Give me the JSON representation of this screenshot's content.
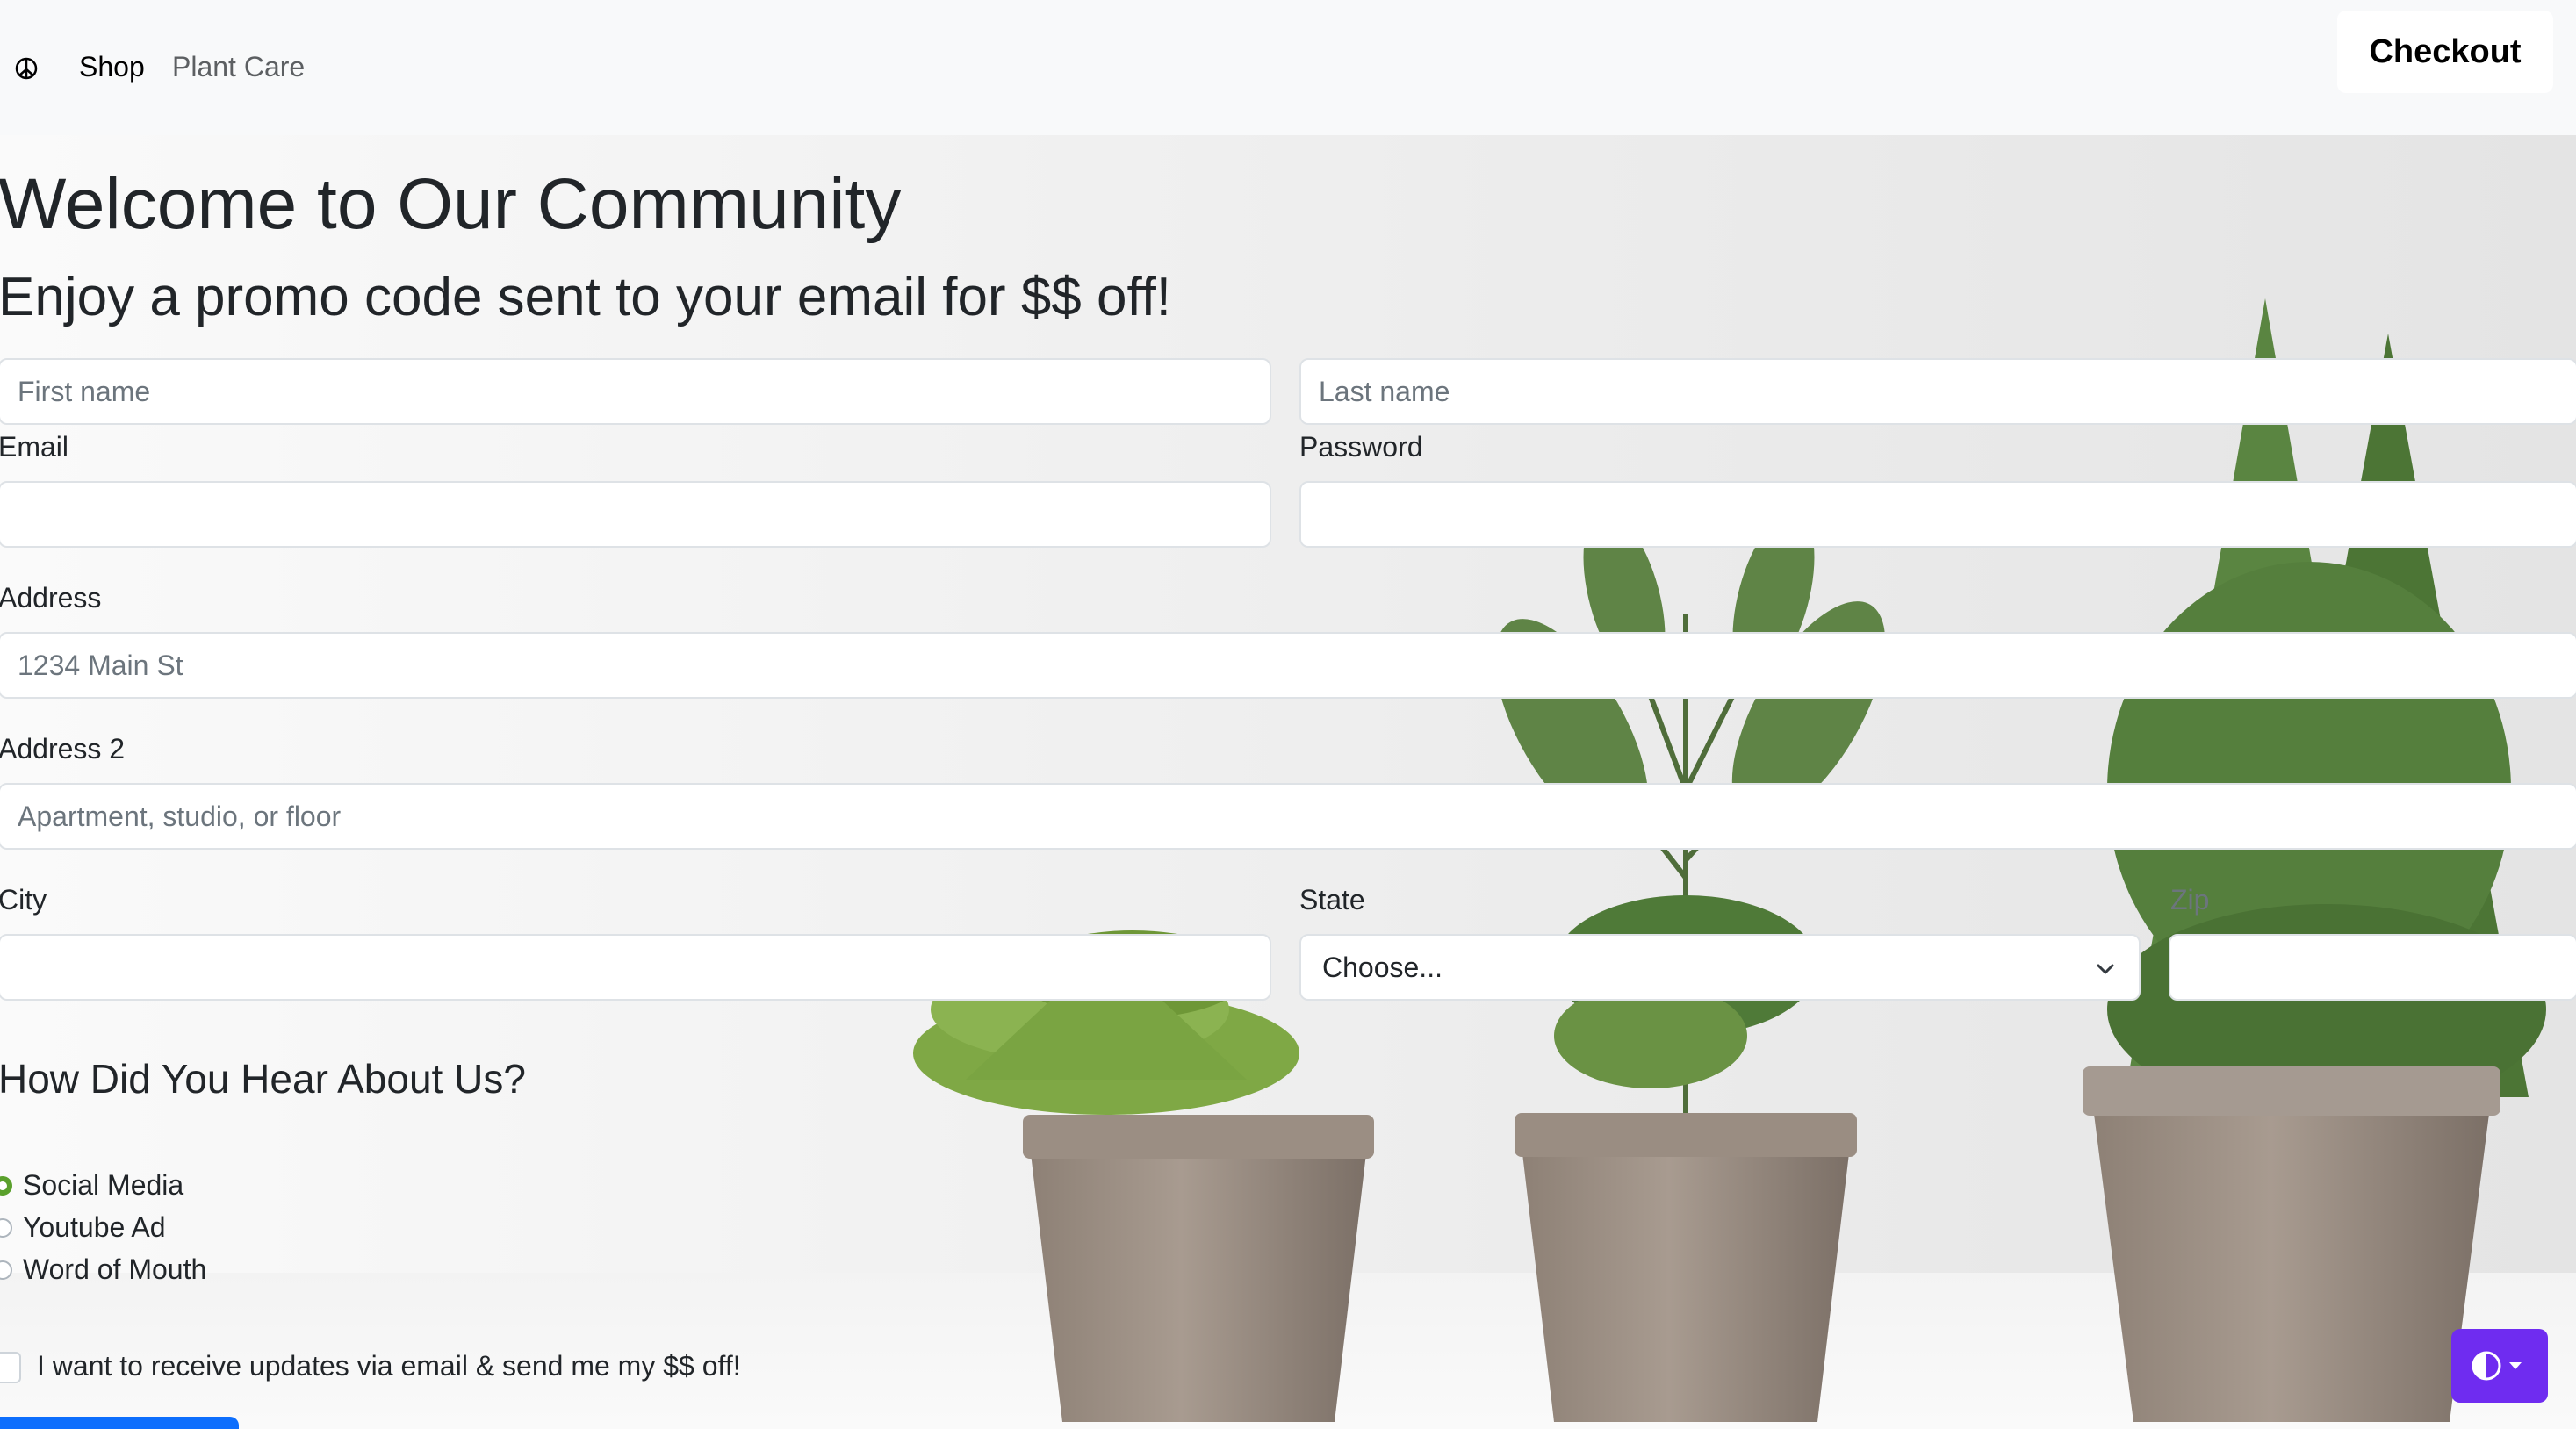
{
  "navbar": {
    "brand_icon": "peace-icon",
    "links": [
      "Shop",
      "Plant Care"
    ],
    "checkout_label": "Checkout"
  },
  "hero": {
    "title": "Welcome to Our Community",
    "subtitle": "Enjoy a promo code sent to your email for $$ off!"
  },
  "form": {
    "first_name": {
      "placeholder": "First name",
      "value": ""
    },
    "last_name": {
      "placeholder": "Last name",
      "value": ""
    },
    "email": {
      "label": "Email",
      "value": ""
    },
    "password": {
      "label": "Password",
      "value": ""
    },
    "address": {
      "label": "Address",
      "placeholder": "1234 Main St",
      "value": ""
    },
    "address2": {
      "label": "Address 2",
      "placeholder": "Apartment, studio, or floor",
      "value": ""
    },
    "city": {
      "label": "City",
      "value": ""
    },
    "state": {
      "label": "State",
      "selected": "Choose..."
    },
    "zip": {
      "label": "Zip",
      "value": ""
    }
  },
  "survey": {
    "title": "How Did You Hear About Us?",
    "options": [
      {
        "label": "Social Media",
        "checked": true
      },
      {
        "label": "Youtube Ad",
        "checked": false
      },
      {
        "label": "Word of Mouth",
        "checked": false
      }
    ]
  },
  "consent": {
    "label": "I want to receive updates via email & send me my $$ off!",
    "checked": false
  },
  "theme_toggle": {
    "icon": "contrast-icon",
    "caret_icon": "caret-down-icon",
    "color": "#6f2cf0"
  },
  "colors": {
    "navbar_bg": "#f8f9fa",
    "radio_accent": "#5aa02c",
    "primary_button": "#0d6efd"
  }
}
